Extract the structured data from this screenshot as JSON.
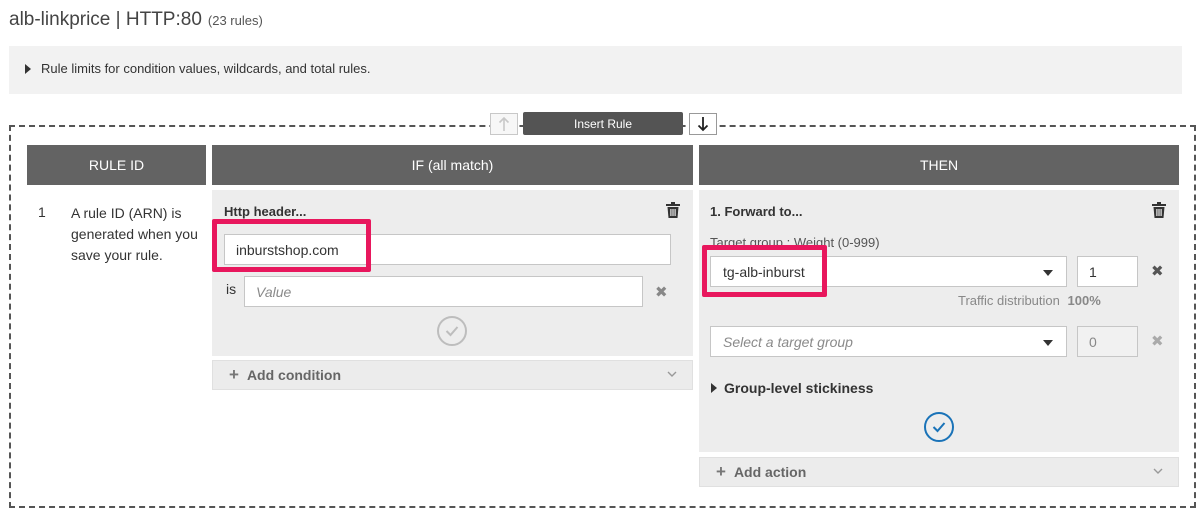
{
  "header": {
    "title": "alb-linkprice | HTTP:80",
    "rule_count": "(23 rules)"
  },
  "info": {
    "text": "Rule limits for condition values, wildcards, and total rules."
  },
  "insert": {
    "label": "Insert Rule"
  },
  "columns": {
    "rule_id": "RULE ID",
    "if": "IF (all match)",
    "then": "THEN"
  },
  "rule": {
    "number": "1",
    "description": "A rule ID (ARN) is generated when you save your rule."
  },
  "condition": {
    "title": "Http header...",
    "header_name": "inburstshop.com",
    "operator": "is",
    "value_placeholder": "Value",
    "add_label": "Add condition"
  },
  "action": {
    "title": "1. Forward to...",
    "target_label": "Target group : Weight (0-999)",
    "target_group": "tg-alb-inburst",
    "weight": "1",
    "traffic_label": "Traffic distribution",
    "traffic_value": "100%",
    "second_target_placeholder": "Select a target group",
    "second_weight": "0",
    "stickiness_label": "Group-level stickiness",
    "add_label": "Add action"
  },
  "colors": {
    "header_bg": "#636363",
    "highlight": "#e8175d",
    "confirm_blue": "#1a73b8"
  }
}
